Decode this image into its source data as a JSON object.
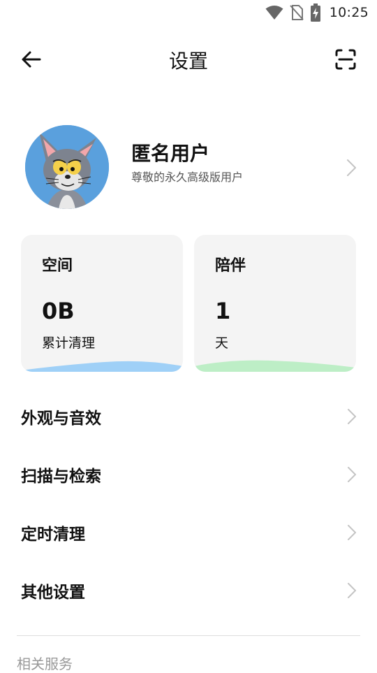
{
  "status_bar": {
    "time": "10:25",
    "icons": [
      "wifi-icon",
      "no-sim-icon",
      "battery-charging-icon"
    ]
  },
  "header": {
    "title": "设置",
    "back_icon": "arrow-left-icon",
    "scan_icon": "scan-frame-icon"
  },
  "profile": {
    "name": "匿名用户",
    "description": "尊敬的永久高级版用户",
    "avatar": "cartoon-cat-avatar",
    "chevron_icon": "chevron-right-icon"
  },
  "cards": [
    {
      "title": "空间",
      "value": "0B",
      "caption": "累计清理",
      "accent": "#9fd0f7"
    },
    {
      "title": "陪伴",
      "value": "1",
      "caption": "天",
      "accent": "#bdeec6"
    }
  ],
  "menu": [
    {
      "label": "外观与音效"
    },
    {
      "label": "扫描与检索"
    },
    {
      "label": "定时清理"
    },
    {
      "label": "其他设置"
    }
  ],
  "section": {
    "label": "相关服务"
  },
  "colors": {
    "background": "#ffffff",
    "card_background": "#f4f4f4",
    "primary_text": "#111111",
    "secondary_text": "#555555",
    "muted_text": "#999999",
    "chevron": "#c4c4c4"
  }
}
